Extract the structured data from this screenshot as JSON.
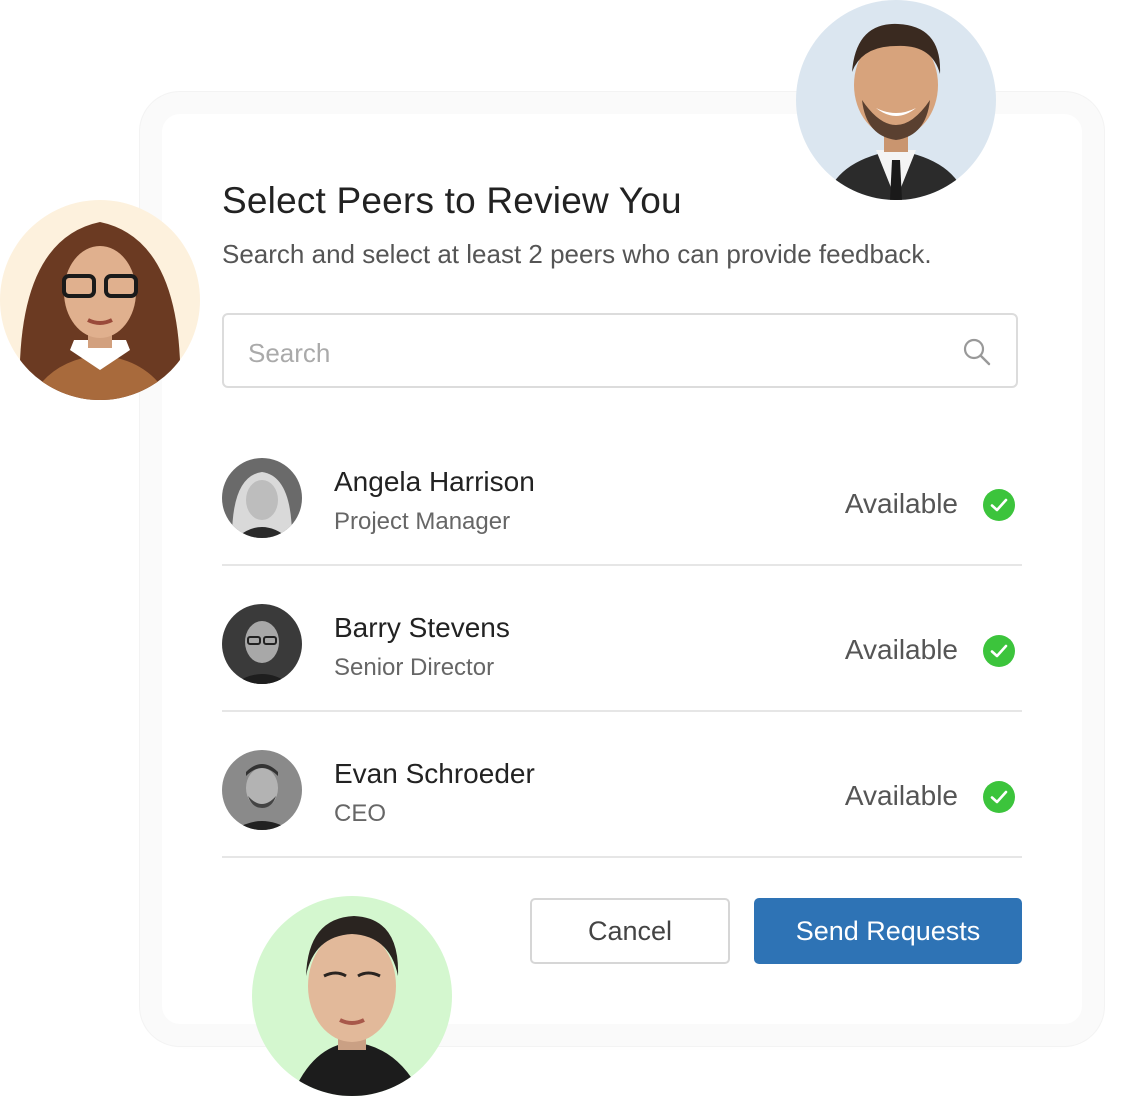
{
  "dialog": {
    "title": "Select Peers to Review You",
    "subtitle": "Search and select at least 2 peers who can provide feedback."
  },
  "search": {
    "placeholder": "Search",
    "value": "",
    "icon": "search-icon"
  },
  "peers": [
    {
      "name": "Angela Harrison",
      "role": "Project Manager",
      "status": "Available"
    },
    {
      "name": "Barry Stevens",
      "role": "Senior Director",
      "status": "Available"
    },
    {
      "name": "Evan Schroeder",
      "role": "CEO",
      "status": "Available"
    }
  ],
  "actions": {
    "cancel_label": "Cancel",
    "send_label": "Send Requests"
  },
  "colors": {
    "accent": "#2e73b5",
    "available": "#3cc43c",
    "divider": "#e6e6e6"
  }
}
